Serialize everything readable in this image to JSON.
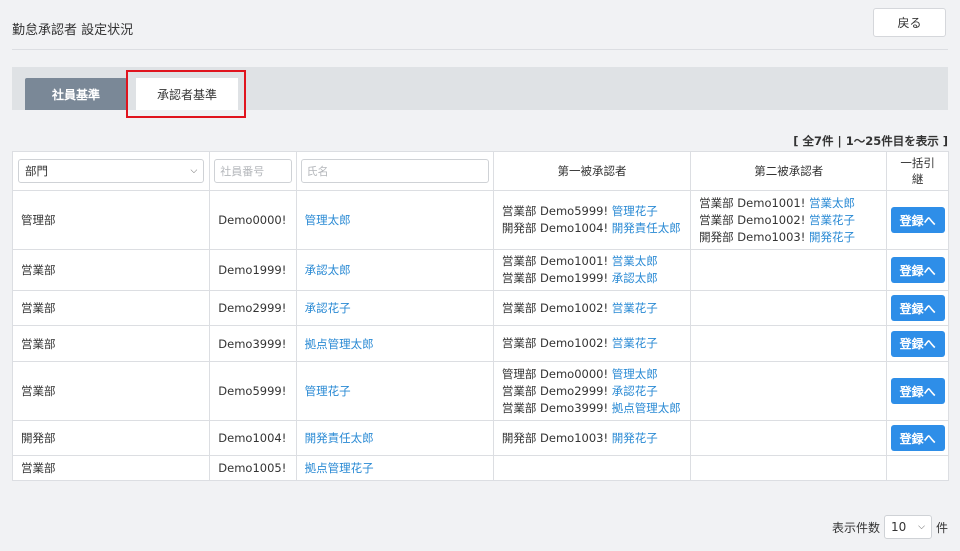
{
  "header": {
    "title": "勤怠承認者 設定状況",
    "back_label": "戻る"
  },
  "tabs": [
    {
      "label": "社員基準",
      "active": false
    },
    {
      "label": "承認者基準",
      "active": true
    }
  ],
  "record_count_text": "[ 全7件 | 1〜25件目を表示 ]",
  "table": {
    "filters": {
      "dept_value": "部門",
      "emp_num_placeholder": "社員番号",
      "name_placeholder": "氏名"
    },
    "headers": {
      "first_approver": "第一被承認者",
      "second_approver": "第二被承認者",
      "bulk": "一括引継"
    },
    "rows": [
      {
        "dept": "管理部",
        "emp_num": "Demo0000!",
        "name": "管理太郎",
        "first": [
          {
            "prefix": "営業部 Demo5999!",
            "name": "管理花子"
          },
          {
            "prefix": "開発部 Demo1004!",
            "name": "開発責任太郎"
          }
        ],
        "second": [
          {
            "prefix": "営業部 Demo1001!",
            "name": "営業太郎"
          },
          {
            "prefix": "営業部 Demo1002!",
            "name": "営業花子"
          },
          {
            "prefix": "開発部 Demo1003!",
            "name": "開発花子"
          }
        ],
        "button": "登録へ"
      },
      {
        "dept": "営業部",
        "emp_num": "Demo1999!",
        "name": "承認太郎",
        "first": [
          {
            "prefix": "営業部 Demo1001!",
            "name": "営業太郎"
          },
          {
            "prefix": "営業部 Demo1999!",
            "name": "承認太郎"
          }
        ],
        "second": [],
        "button": "登録へ"
      },
      {
        "dept": "営業部",
        "emp_num": "Demo2999!",
        "name": "承認花子",
        "first": [
          {
            "prefix": "営業部 Demo1002!",
            "name": "営業花子"
          }
        ],
        "second": [],
        "button": "登録へ"
      },
      {
        "dept": "営業部",
        "emp_num": "Demo3999!",
        "name": "拠点管理太郎",
        "first": [
          {
            "prefix": "営業部 Demo1002!",
            "name": "営業花子"
          }
        ],
        "second": [],
        "button": "登録へ"
      },
      {
        "dept": "営業部",
        "emp_num": "Demo5999!",
        "name": "管理花子",
        "first": [
          {
            "prefix": "管理部 Demo0000!",
            "name": "管理太郎"
          },
          {
            "prefix": "営業部 Demo2999!",
            "name": "承認花子"
          },
          {
            "prefix": "営業部 Demo3999!",
            "name": "拠点管理太郎"
          }
        ],
        "second": [],
        "button": "登録へ"
      },
      {
        "dept": "開発部",
        "emp_num": "Demo1004!",
        "name": "開発責任太郎",
        "first": [
          {
            "prefix": "開発部 Demo1003!",
            "name": "開発花子"
          }
        ],
        "second": [],
        "button": "登録へ"
      },
      {
        "dept": "営業部",
        "emp_num": "Demo1005!",
        "name": "拠点管理花子",
        "first": [],
        "second": [],
        "button": ""
      }
    ]
  },
  "pager": {
    "label_before": "表示件数",
    "page_size": "10",
    "label_after": "件"
  },
  "colors": {
    "accent_blue": "#2e8ee8",
    "link_blue": "#2a8ad4",
    "highlight_red": "#e0141e",
    "tab_inactive": "#7a8897"
  }
}
